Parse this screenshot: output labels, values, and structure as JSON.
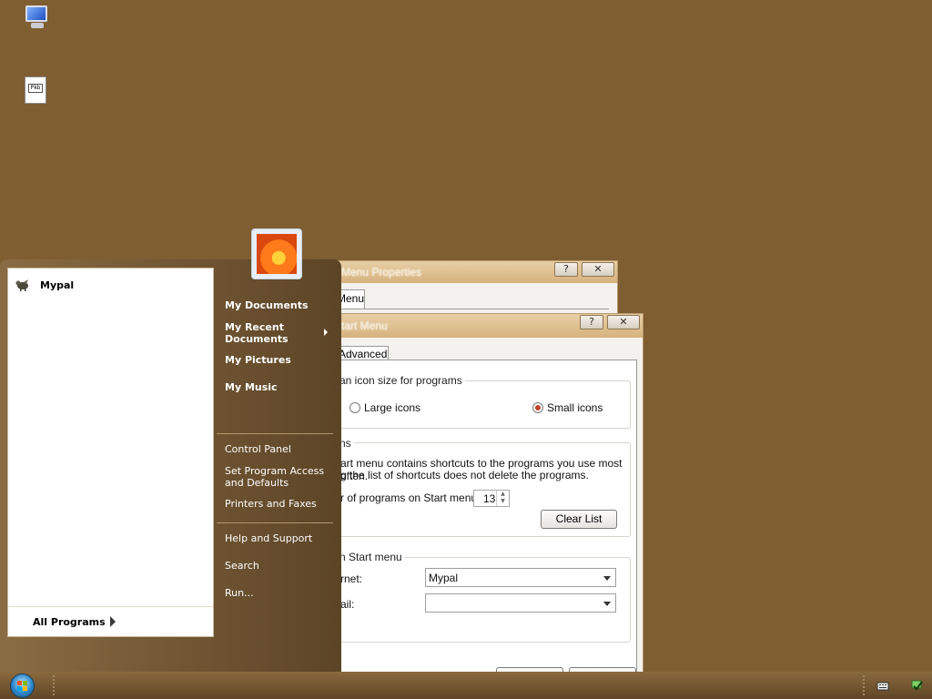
{
  "desktop": {
    "icons": [
      {
        "name": "computer-icon"
      },
      {
        "name": "document-icon",
        "label_text": "Pkb"
      }
    ]
  },
  "back_window": {
    "title": "Taskbar and Start Menu Properties",
    "title_visible": "Menu Properties",
    "tab_visible": "Menu",
    "help_symbol": "?",
    "close_symbol": "✕"
  },
  "front_window": {
    "title": "Customize Start Menu",
    "title_visible": "tart Menu",
    "help_symbol": "?",
    "close_symbol": "✕",
    "tab_advanced": "Advanced",
    "icon_size_group": {
      "label": "an icon size for programs",
      "large_icons": "Large icons",
      "small_icons": "Small icons",
      "selected": "Small icons"
    },
    "programs_group": {
      "label": "ns",
      "line1": "art menu contains shortcuts to the programs you use most often.",
      "line2": "g the list of shortcuts does not delete the programs.",
      "count_label": "r of programs on Start menu:",
      "count_value": "13",
      "clear_list": "Clear List"
    },
    "show_group": {
      "label": "n Start menu",
      "internet_label": "rnet:",
      "internet_value": "Mypal",
      "email_label": "ail:",
      "email_value": ""
    }
  },
  "start_menu": {
    "pinned": [
      {
        "label": "Mypal"
      }
    ],
    "all_programs": "All Programs",
    "right_items": [
      {
        "label": "My Documents"
      },
      {
        "label": "My Recent Documents",
        "line1": "My Recent",
        "line2": "Documents"
      },
      {
        "label": "My Pictures"
      },
      {
        "label": "My Music"
      },
      {
        "label": "Control Panel"
      },
      {
        "label": "Set Program Access and Defaults",
        "line1": "Set Program Access",
        "line2": "and Defaults"
      },
      {
        "label": "Printers and Faxes"
      },
      {
        "label": "Help and Support"
      },
      {
        "label": "Search"
      },
      {
        "label": "Run..."
      }
    ]
  },
  "taskbar": {
    "start_button": "start-orb",
    "tray_icons": [
      "keyboard-icon",
      "network-icon"
    ]
  },
  "colors": {
    "desktop": "#7f5e32",
    "window_title": "#d6b27d",
    "radio_selected": "#c0432a"
  }
}
